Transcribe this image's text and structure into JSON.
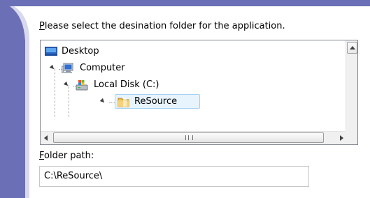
{
  "prompt": {
    "mnemonic": "P",
    "rest": "lease select the desination folder for the application."
  },
  "tree": {
    "nodes": [
      {
        "label": "Desktop",
        "icon": "desktop-icon",
        "expanded": true
      },
      {
        "label": "Computer",
        "icon": "computer-icon",
        "expanded": true
      },
      {
        "label": "Local Disk (C:)",
        "icon": "local-disk-icon",
        "expanded": true
      },
      {
        "label": "ReSource",
        "icon": "folder-icon",
        "expanded": true,
        "selected": true
      }
    ]
  },
  "folder_path": {
    "label_mnemonic": "F",
    "label_rest": "older path:",
    "value": "C:\\ReSource\\"
  },
  "colors": {
    "title_strip": "#6b6fb5",
    "swoosh": "#6b6fb5",
    "selection_fill": "#e7f3fd",
    "selection_border": "#a7d1f2"
  }
}
